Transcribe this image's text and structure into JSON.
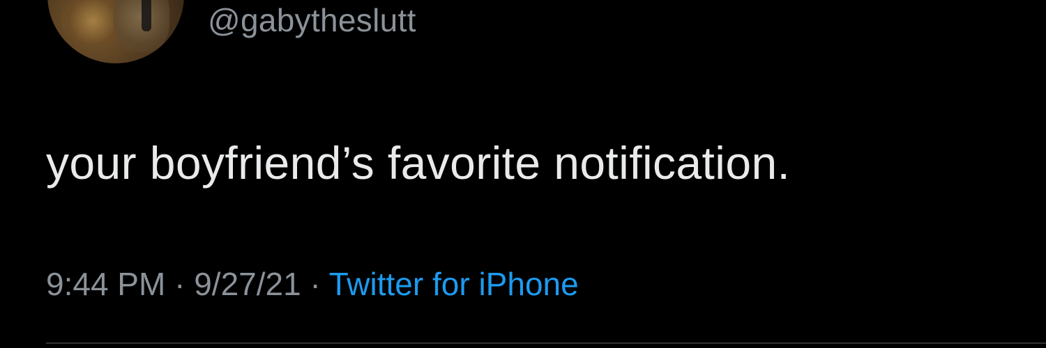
{
  "tweet": {
    "handle": "@gabytheslutt",
    "text": "your boyfriend’s favorite notification.",
    "time": "9:44 PM",
    "separator1": " · ",
    "date": "9/27/21",
    "separator2": " · ",
    "source": "Twitter for iPhone"
  },
  "colors": {
    "background": "#000000",
    "text": "#e9eaeb",
    "secondary_text": "#8b9299",
    "link": "#1d9bf0"
  }
}
